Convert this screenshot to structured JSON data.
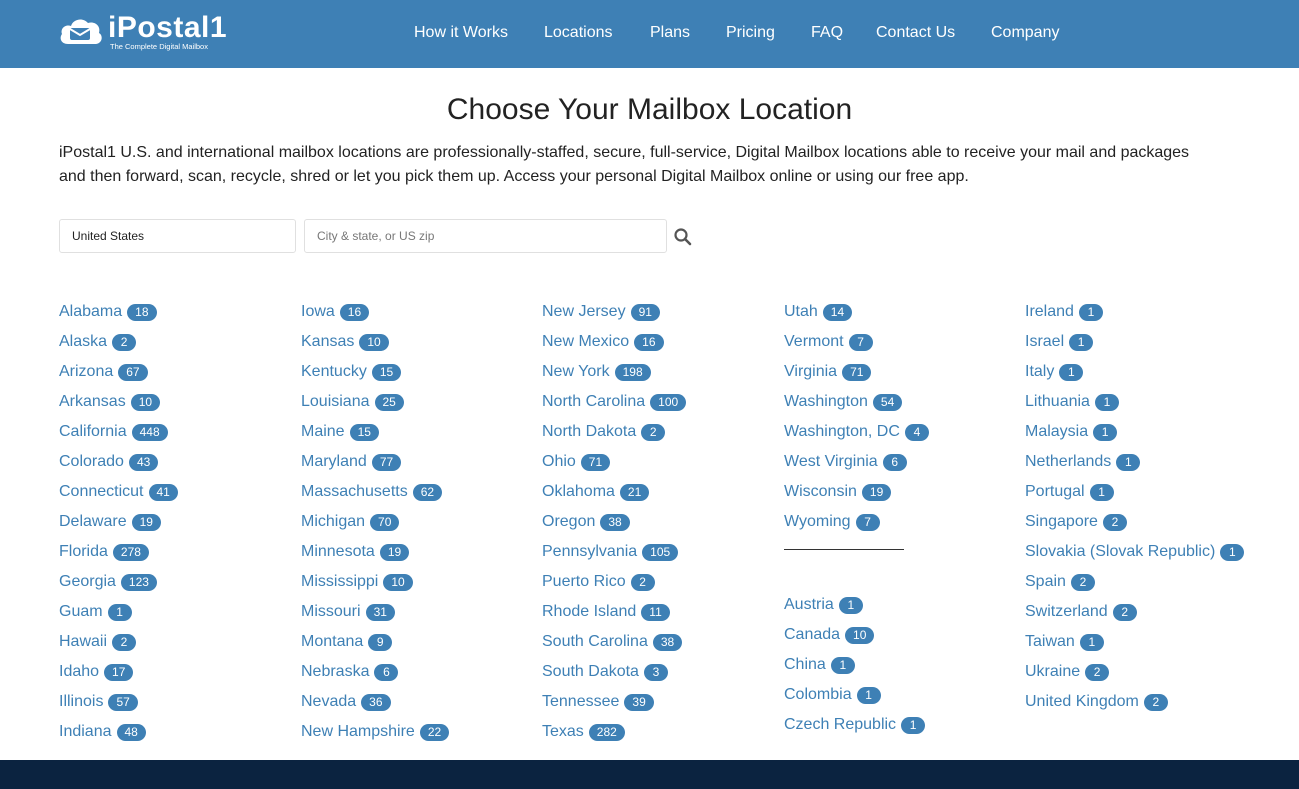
{
  "brand": {
    "name": "iPostal1",
    "tagline": "The Complete Digital Mailbox"
  },
  "nav": [
    "How it Works",
    "Locations",
    "Plans",
    "Pricing",
    "FAQ",
    "Contact Us",
    "Company"
  ],
  "page": {
    "title": "Choose Your Mailbox Location",
    "intro": "iPostal1 U.S. and international mailbox locations are professionally-staffed, secure, full-service, Digital Mailbox locations able to receive your mail and packages and then forward, scan, recycle, shred or let you pick them up. Access your personal Digital Mailbox online or using our free app."
  },
  "search": {
    "country": "United States",
    "placeholder": "City & state, or US zip"
  },
  "columns": [
    [
      {
        "name": "Alabama",
        "count": "18"
      },
      {
        "name": "Alaska",
        "count": "2"
      },
      {
        "name": "Arizona",
        "count": "67"
      },
      {
        "name": "Arkansas",
        "count": "10"
      },
      {
        "name": "California",
        "count": "448"
      },
      {
        "name": "Colorado",
        "count": "43"
      },
      {
        "name": "Connecticut",
        "count": "41"
      },
      {
        "name": "Delaware",
        "count": "19"
      },
      {
        "name": "Florida",
        "count": "278"
      },
      {
        "name": "Georgia",
        "count": "123"
      },
      {
        "name": "Guam",
        "count": "1"
      },
      {
        "name": "Hawaii",
        "count": "2"
      },
      {
        "name": "Idaho",
        "count": "17"
      },
      {
        "name": "Illinois",
        "count": "57"
      },
      {
        "name": "Indiana",
        "count": "48"
      }
    ],
    [
      {
        "name": "Iowa",
        "count": "16"
      },
      {
        "name": "Kansas",
        "count": "10"
      },
      {
        "name": "Kentucky",
        "count": "15"
      },
      {
        "name": "Louisiana",
        "count": "25"
      },
      {
        "name": "Maine",
        "count": "15"
      },
      {
        "name": "Maryland",
        "count": "77"
      },
      {
        "name": "Massachusetts",
        "count": "62"
      },
      {
        "name": "Michigan",
        "count": "70"
      },
      {
        "name": "Minnesota",
        "count": "19"
      },
      {
        "name": "Mississippi",
        "count": "10"
      },
      {
        "name": "Missouri",
        "count": "31"
      },
      {
        "name": "Montana",
        "count": "9"
      },
      {
        "name": "Nebraska",
        "count": "6"
      },
      {
        "name": "Nevada",
        "count": "36"
      },
      {
        "name": "New Hampshire",
        "count": "22"
      }
    ],
    [
      {
        "name": "New Jersey",
        "count": "91"
      },
      {
        "name": "New Mexico",
        "count": "16"
      },
      {
        "name": "New York",
        "count": "198"
      },
      {
        "name": "North Carolina",
        "count": "100"
      },
      {
        "name": "North Dakota",
        "count": "2"
      },
      {
        "name": "Ohio",
        "count": "71"
      },
      {
        "name": "Oklahoma",
        "count": "21"
      },
      {
        "name": "Oregon",
        "count": "38"
      },
      {
        "name": "Pennsylvania",
        "count": "105"
      },
      {
        "name": "Puerto Rico",
        "count": "2"
      },
      {
        "name": "Rhode Island",
        "count": "11"
      },
      {
        "name": "South Carolina",
        "count": "38"
      },
      {
        "name": "South Dakota",
        "count": "3"
      },
      {
        "name": "Tennessee",
        "count": "39"
      },
      {
        "name": "Texas",
        "count": "282"
      }
    ],
    [
      {
        "name": "Utah",
        "count": "14"
      },
      {
        "name": "Vermont",
        "count": "7"
      },
      {
        "name": "Virginia",
        "count": "71"
      },
      {
        "name": "Washington",
        "count": "54"
      },
      {
        "name": "Washington, DC",
        "count": "4"
      },
      {
        "name": "West Virginia",
        "count": "6"
      },
      {
        "name": "Wisconsin",
        "count": "19"
      },
      {
        "name": "Wyoming",
        "count": "7"
      }
    ],
    [
      {
        "name": "Ireland",
        "count": "1"
      },
      {
        "name": "Israel",
        "count": "1"
      },
      {
        "name": "Italy",
        "count": "1"
      },
      {
        "name": "Lithuania",
        "count": "1"
      },
      {
        "name": "Malaysia",
        "count": "1"
      },
      {
        "name": "Netherlands",
        "count": "1"
      },
      {
        "name": "Portugal",
        "count": "1"
      },
      {
        "name": "Singapore",
        "count": "2"
      },
      {
        "name": "Slovakia (Slovak Republic)",
        "count": "1"
      },
      {
        "name": "Spain",
        "count": "2"
      },
      {
        "name": "Switzerland",
        "count": "2"
      },
      {
        "name": "Taiwan",
        "count": "1"
      },
      {
        "name": "Ukraine",
        "count": "2"
      },
      {
        "name": "United Kingdom",
        "count": "2"
      }
    ]
  ],
  "international_col4": [
    {
      "name": "Austria",
      "count": "1"
    },
    {
      "name": "Canada",
      "count": "10"
    },
    {
      "name": "China",
      "count": "1"
    },
    {
      "name": "Colombia",
      "count": "1"
    },
    {
      "name": "Czech Republic",
      "count": "1"
    }
  ],
  "colors": {
    "brand_blue": "#3e80b5",
    "footer_navy": "#0b2340"
  },
  "icons": {
    "logo": "mailbox-cloud-icon",
    "search": "search-icon"
  }
}
